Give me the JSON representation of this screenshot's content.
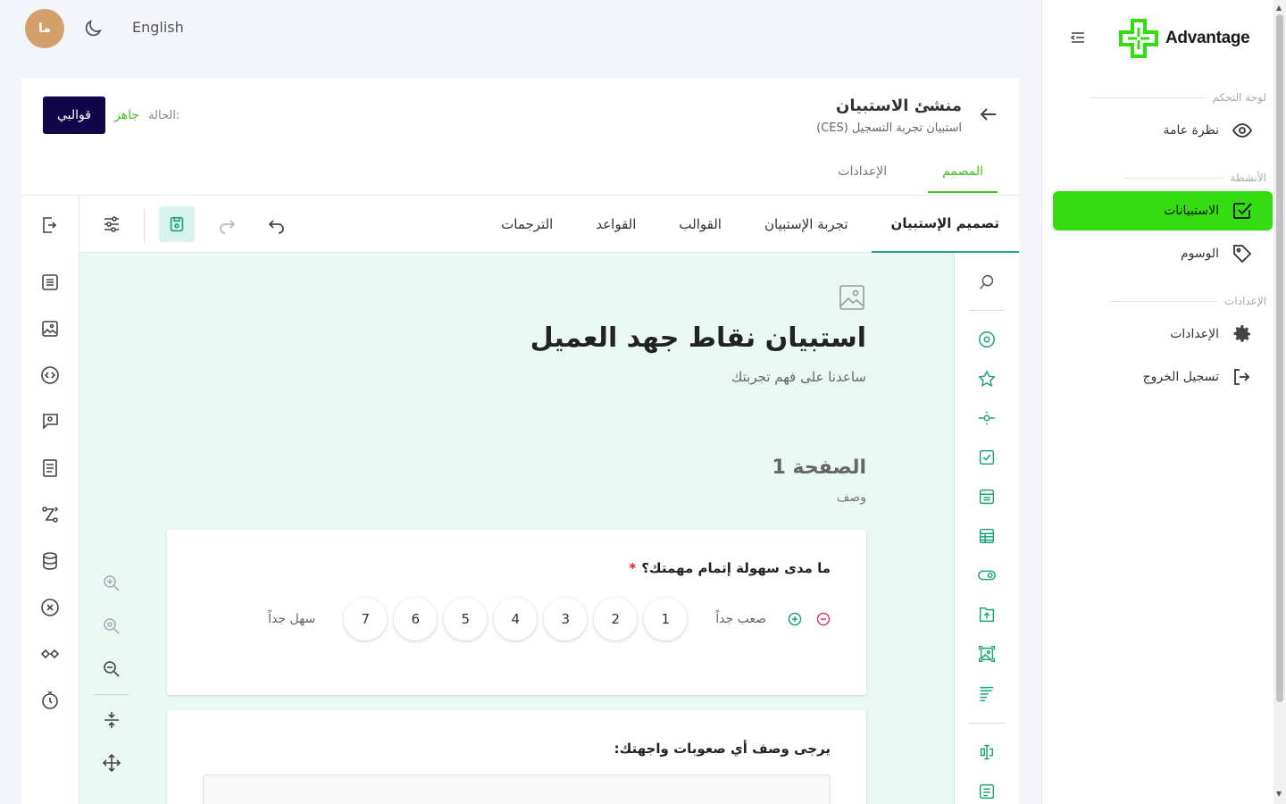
{
  "topbar": {
    "avatar_initials": "ما",
    "theme_icon": "moon-icon",
    "language": "English"
  },
  "sidebar": {
    "logo_text": "Advantage",
    "brand_color": "#33dd11",
    "section_dashboard": "لوحة التحكم",
    "overview": "نظرة عامة",
    "section_activities": "الأنشطة",
    "surveys": "الاستبيانات",
    "tags": "الوسوم",
    "section_settings": "الإعدادات",
    "settings": "الإعدادات",
    "logout": "تسجيل الخروج"
  },
  "header": {
    "title": "منشئ الاستبيان",
    "subtitle": "استبيان تجربة التسجيل (CES)",
    "status_label": "الحالة:",
    "status_value": "جاهز",
    "templates_button": "قوالبي",
    "tab_designer": "المصمم",
    "tab_settings": "الإعدادات"
  },
  "toolbar": {
    "tabs": [
      "تصميم الإستبيان",
      "تجربة الإستبيان",
      "القوالب",
      "القواعد",
      "الترجمات"
    ],
    "active_tab": "تصميم الإستبيان"
  },
  "survey": {
    "title": "استبيان نقاط جهد العميل",
    "description": "ساعدنا على فهم تجربتك",
    "page_title": "الصفحة 1",
    "page_description": "وصف",
    "q1": {
      "title": "ما مدى سهولة إتمام مهمتك؟",
      "required_mark": "*",
      "min_label": "صعب جداً",
      "max_label": "سهل جداً",
      "values": [
        "1",
        "2",
        "3",
        "4",
        "5",
        "6",
        "7"
      ]
    },
    "q2": {
      "title": "يرجى وصف أي صعوبات واجهتك:"
    }
  }
}
